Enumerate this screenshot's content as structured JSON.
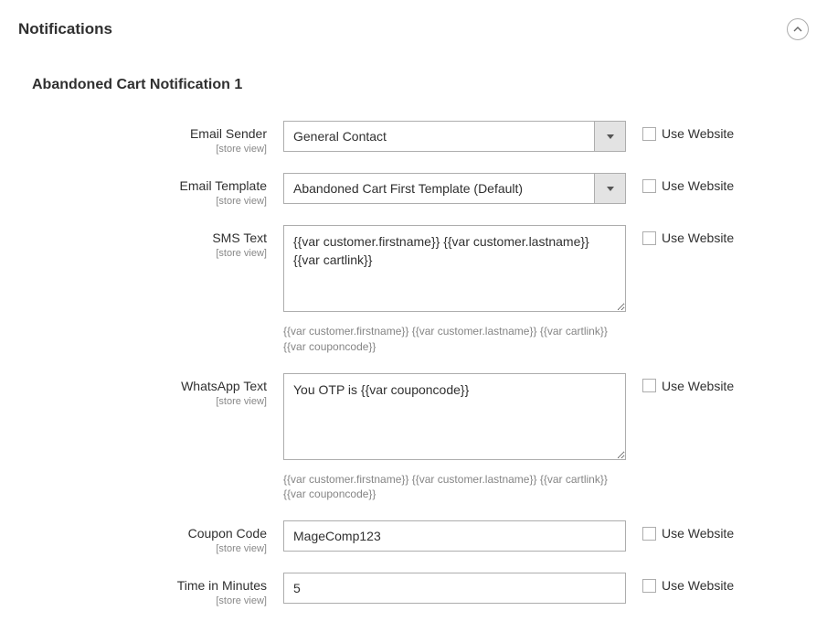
{
  "section": {
    "title": "Notifications"
  },
  "subsection": {
    "title": "Abandoned Cart Notification 1"
  },
  "scope_label": "[store view]",
  "use_website_label": "Use Website",
  "fields": {
    "email_sender": {
      "label": "Email Sender",
      "value": "General Contact"
    },
    "email_template": {
      "label": "Email Template",
      "value": "Abandoned Cart First Template (Default)"
    },
    "sms_text": {
      "label": "SMS Text",
      "value": "{{var customer.firstname}} {{var customer.lastname}} {{var cartlink}}",
      "hint": "{{var customer.firstname}} {{var customer.lastname}} {{var cartlink}} {{var couponcode}}"
    },
    "whatsapp_text": {
      "label": "WhatsApp Text",
      "value": "You OTP is {{var couponcode}}",
      "hint": "{{var customer.firstname}} {{var customer.lastname}} {{var cartlink}} {{var couponcode}}"
    },
    "coupon_code": {
      "label": "Coupon Code",
      "value": "MageComp123"
    },
    "time_minutes": {
      "label": "Time in Minutes",
      "value": "5"
    }
  }
}
